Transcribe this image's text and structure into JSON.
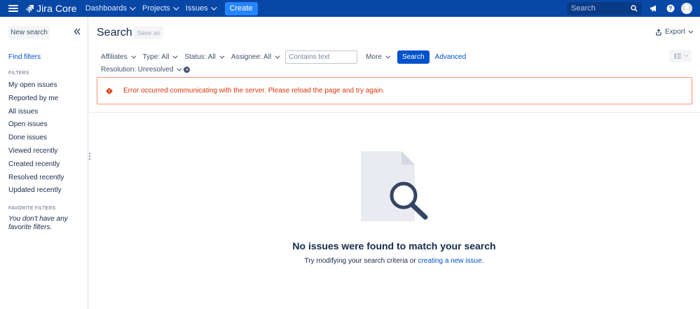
{
  "topnav": {
    "product_name": "Jira Core",
    "items": [
      {
        "label": "Dashboards"
      },
      {
        "label": "Projects"
      },
      {
        "label": "Issues"
      }
    ],
    "create_label": "Create",
    "search_placeholder": "Search",
    "icons": [
      "menu-icon",
      "jira-logo-icon",
      "megaphone-icon",
      "help-icon",
      "avatar"
    ]
  },
  "sidebar": {
    "new_search_label": "New search",
    "find_filters_label": "Find filters",
    "filters_header": "FILTERS",
    "filters": [
      "My open issues",
      "Reported by me",
      "All issues",
      "Open issues",
      "Done issues",
      "Viewed recently",
      "Created recently",
      "Resolved recently",
      "Updated recently"
    ],
    "favorites_header": "FAVORITE FILTERS",
    "favorites_empty_line1": "You don't have any",
    "favorites_empty_line2": "favorite filters."
  },
  "main": {
    "title": "Search",
    "save_as_label": "Save as",
    "export_label": "Export",
    "filter_bar": {
      "affiliates": "Affiliates",
      "type": "Type: All",
      "status": "Status: All",
      "assignee": "Assignee: All",
      "text_placeholder": "Contains text",
      "more": "More",
      "search_button": "Search",
      "advanced": "Advanced"
    },
    "resolution_label": "Resolution: Unresolved",
    "error_message": "Error occurred communicating with the server. Please reload the page and try again.",
    "empty_title": "No issues were found to match your search",
    "empty_sub_prefix": "Try modifying your search criteria or ",
    "empty_sub_link": "creating a new issue",
    "empty_sub_suffix": "."
  },
  "colors": {
    "nav_bg": "#0747a6",
    "primary": "#0052cc",
    "create_button": "#2684ff",
    "error_border": "#ff8f73",
    "error_text": "#de350b"
  }
}
